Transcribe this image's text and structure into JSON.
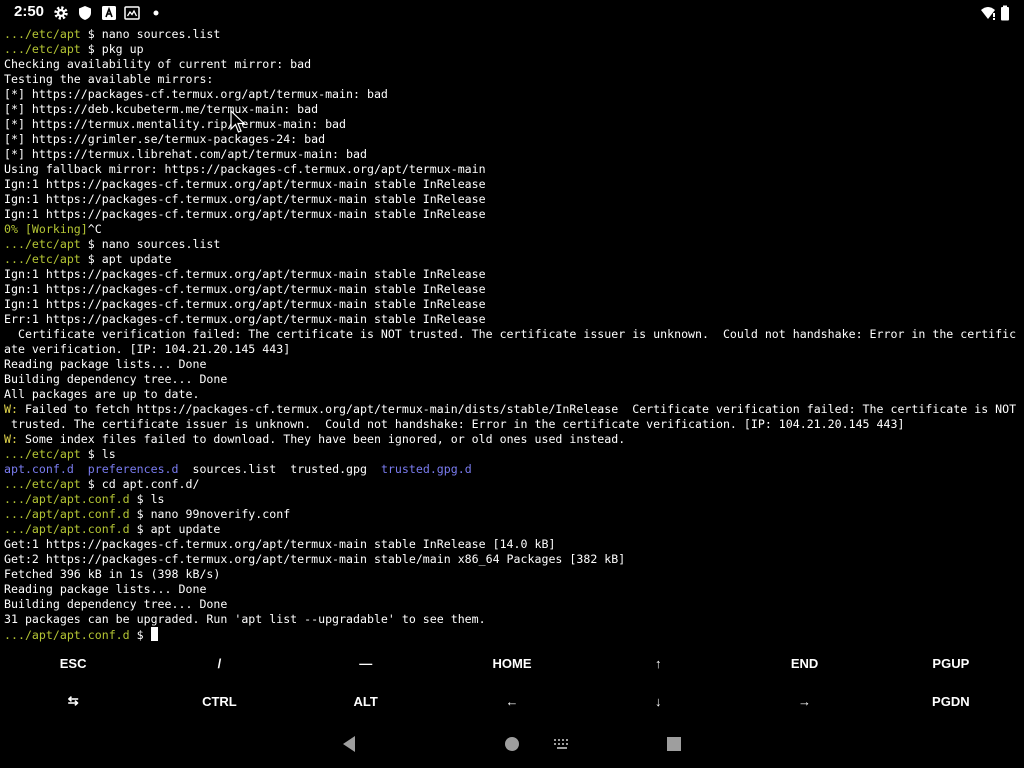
{
  "status_bar": {
    "time": "2:50",
    "left_icons": [
      "settings-gear-icon",
      "shield-icon",
      "font-a-icon",
      "screen-icon",
      "dot-icon"
    ],
    "right_icons": [
      "wifi-alert-icon",
      "battery-icon"
    ]
  },
  "terminal": {
    "lines": [
      [
        {
          "t": ".../etc/apt",
          "c": "prompt-path"
        },
        {
          "t": " $ nano sources.list"
        }
      ],
      [
        {
          "t": ".../etc/apt",
          "c": "prompt-path"
        },
        {
          "t": " $ pkg up"
        }
      ],
      [
        {
          "t": "Checking availability of current mirror: bad"
        }
      ],
      [
        {
          "t": "Testing the available mirrors:"
        }
      ],
      [
        {
          "t": "[*] https://packages-cf.termux.org/apt/termux-main: bad"
        }
      ],
      [
        {
          "t": "[*] https://deb.kcubeterm.me/termux-main: bad"
        }
      ],
      [
        {
          "t": "[*] https://termux.mentality.rip/termux-main: bad"
        }
      ],
      [
        {
          "t": "[*] https://grimler.se/termux-packages-24: bad"
        }
      ],
      [
        {
          "t": "[*] https://termux.librehat.com/apt/termux-main: bad"
        }
      ],
      [
        {
          "t": "Using fallback mirror: https://packages-cf.termux.org/apt/termux-main"
        }
      ],
      [
        {
          "t": "Ign:1 https://packages-cf.termux.org/apt/termux-main stable InRelease"
        }
      ],
      [
        {
          "t": "Ign:1 https://packages-cf.termux.org/apt/termux-main stable InRelease"
        }
      ],
      [
        {
          "t": "Ign:1 https://packages-cf.termux.org/apt/termux-main stable InRelease"
        }
      ],
      [
        {
          "t": "0% [Working]",
          "c": "prompt-path"
        },
        {
          "t": "^C"
        }
      ],
      [
        {
          "t": ".../etc/apt",
          "c": "prompt-path"
        },
        {
          "t": " $ nano sources.list"
        }
      ],
      [
        {
          "t": ".../etc/apt",
          "c": "prompt-path"
        },
        {
          "t": " $ apt update"
        }
      ],
      [
        {
          "t": "Ign:1 https://packages-cf.termux.org/apt/termux-main stable InRelease"
        }
      ],
      [
        {
          "t": "Ign:1 https://packages-cf.termux.org/apt/termux-main stable InRelease"
        }
      ],
      [
        {
          "t": "Ign:1 https://packages-cf.termux.org/apt/termux-main stable InRelease"
        }
      ],
      [
        {
          "t": "Err:1 https://packages-cf.termux.org/apt/termux-main stable InRelease"
        }
      ],
      [
        {
          "t": "  Certificate verification failed: The certificate is NOT trusted. The certificate issuer is unknown.  Could not handshake: Error in the certific"
        }
      ],
      [
        {
          "t": "ate verification. [IP: 104.21.20.145 443]"
        }
      ],
      [
        {
          "t": "Reading package lists... Done"
        }
      ],
      [
        {
          "t": "Building dependency tree... Done"
        }
      ],
      [
        {
          "t": "All packages are up to date."
        }
      ],
      [
        {
          "t": "W:",
          "c": "prompt-warn"
        },
        {
          "t": " Failed to fetch https://packages-cf.termux.org/apt/termux-main/dists/stable/InRelease  Certificate verification failed: The certificate is NOT"
        }
      ],
      [
        {
          "t": " trusted. The certificate issuer is unknown.  Could not handshake: Error in the certificate verification. [IP: 104.21.20.145 443]"
        }
      ],
      [
        {
          "t": "W:",
          "c": "prompt-warn"
        },
        {
          "t": " Some index files failed to download. They have been ignored, or old ones used instead."
        }
      ],
      [
        {
          "t": ".../etc/apt",
          "c": "prompt-path"
        },
        {
          "t": " $ ls"
        }
      ],
      [
        {
          "t": "apt.conf.d",
          "c": "dir"
        },
        {
          "t": "  "
        },
        {
          "t": "preferences.d",
          "c": "dir"
        },
        {
          "t": "  sources.list  trusted.gpg  "
        },
        {
          "t": "trusted.gpg.d",
          "c": "dir"
        }
      ],
      [
        {
          "t": ".../etc/apt",
          "c": "prompt-path"
        },
        {
          "t": " $ cd apt.conf.d/"
        }
      ],
      [
        {
          "t": ".../apt/apt.conf.d",
          "c": "prompt-path"
        },
        {
          "t": " $ ls"
        }
      ],
      [
        {
          "t": ".../apt/apt.conf.d",
          "c": "prompt-path"
        },
        {
          "t": " $ nano 99noverify.conf"
        }
      ],
      [
        {
          "t": ".../apt/apt.conf.d",
          "c": "prompt-path"
        },
        {
          "t": " $ apt update"
        }
      ],
      [
        {
          "t": "Get:1 https://packages-cf.termux.org/apt/termux-main stable InRelease [14.0 kB]"
        }
      ],
      [
        {
          "t": "Get:2 https://packages-cf.termux.org/apt/termux-main stable/main x86_64 Packages [382 kB]"
        }
      ],
      [
        {
          "t": "Fetched 396 kB in 1s (398 kB/s)"
        }
      ],
      [
        {
          "t": "Reading package lists... Done"
        }
      ],
      [
        {
          "t": "Building dependency tree... Done"
        }
      ],
      [
        {
          "t": "31 packages can be upgraded. Run 'apt list --upgradable' to see them."
        }
      ],
      [
        {
          "t": ".../apt/apt.conf.d",
          "c": "prompt-path"
        },
        {
          "t": " $ "
        },
        {
          "t": "",
          "c": "cursor-block"
        }
      ]
    ]
  },
  "extra_keys": {
    "row1": [
      "ESC",
      "/",
      "—",
      "HOME",
      "↑",
      "END",
      "PGUP"
    ],
    "row2": [
      "⇆",
      "CTRL",
      "ALT",
      "←",
      "↓",
      "→",
      "PGDN"
    ]
  },
  "nav_bar": {
    "buttons": [
      "back-icon",
      "home-icon",
      "keyboard-icon",
      "recents-icon"
    ]
  }
}
